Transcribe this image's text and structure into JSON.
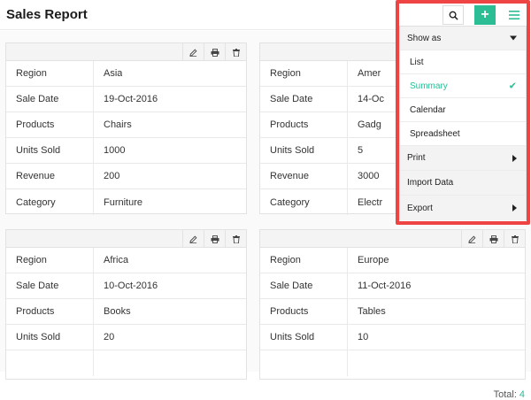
{
  "header": {
    "title": "Sales Report",
    "add_icon": "plus-icon",
    "search_icon": "search-icon",
    "menu_icon": "hamburger-icon"
  },
  "colors": {
    "accent": "#2bbd93",
    "highlight": "#ef4444"
  },
  "labels": {
    "region": "Region",
    "sale_date": "Sale Date",
    "products": "Products",
    "units_sold": "Units Sold",
    "revenue": "Revenue",
    "category": "Category"
  },
  "records": [
    {
      "region": "Asia",
      "sale_date": "19-Oct-2016",
      "products": "Chairs",
      "units_sold": "1000",
      "revenue": "200",
      "category": "Furniture"
    },
    {
      "region": "Amer",
      "sale_date": "14-Oc",
      "products": "Gadg",
      "units_sold": "5",
      "revenue": "3000",
      "category": "Electr"
    },
    {
      "region": "Africa",
      "sale_date": "10-Oct-2016",
      "products": "Books",
      "units_sold": "20"
    },
    {
      "region": "Europe",
      "sale_date": "11-Oct-2016",
      "products": "Tables",
      "units_sold": "10"
    }
  ],
  "card_toolbar_icons": [
    "edit-icon",
    "print-icon",
    "delete-icon"
  ],
  "menu": {
    "show_as": "Show as",
    "options": [
      "List",
      "Summary",
      "Calendar",
      "Spreadsheet"
    ],
    "selected": "Summary",
    "print": "Print",
    "import": "Import Data",
    "export": "Export"
  },
  "footer": {
    "label": "Total:",
    "count": "4"
  }
}
